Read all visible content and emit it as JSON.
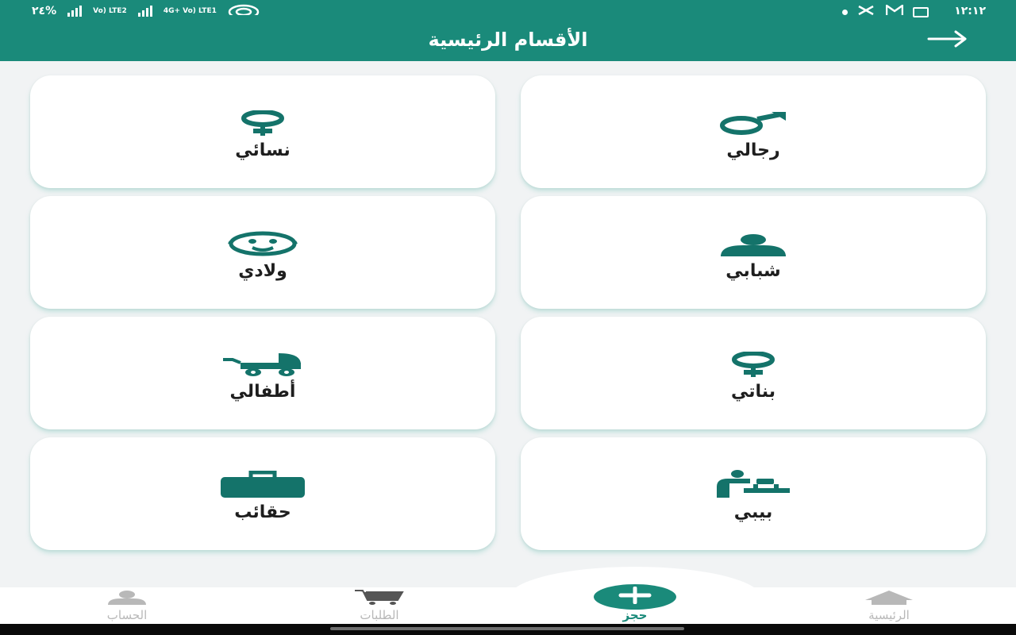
{
  "status_bar": {
    "time": "١٢:١٢",
    "battery": "٢٤%",
    "network_1": "Vo) LTE2",
    "network_2": "4G+ Vo) LTE1"
  },
  "header": {
    "title": "الأقسام الرئيسية",
    "back_icon": "arrow-right-icon"
  },
  "colors": {
    "primary": "#1a8a7a",
    "icon": "#14736a",
    "card_bg": "#ffffff",
    "page_bg": "#f1f3f4",
    "inactive": "#b8b8b8"
  },
  "categories": [
    {
      "label": "رجالي",
      "icon": "male-symbol-icon"
    },
    {
      "label": "نسائي",
      "icon": "female-symbol-icon"
    },
    {
      "label": "شبابي",
      "icon": "young-person-icon"
    },
    {
      "label": "ولادي",
      "icon": "baby-face-icon"
    },
    {
      "label": "بناتي",
      "icon": "female-symbol-icon"
    },
    {
      "label": "أطفالي",
      "icon": "stroller-icon"
    },
    {
      "label": "بيبي",
      "icon": "baby-changing-icon"
    },
    {
      "label": "حقائب",
      "icon": "briefcase-icon"
    }
  ],
  "bottom_nav": {
    "items": [
      {
        "label": "الرئيسية",
        "icon": "home-icon",
        "active": false
      },
      {
        "label": "حجز",
        "icon": "plus-icon",
        "active": true
      },
      {
        "label": "الطلبات",
        "icon": "cart-icon",
        "active": false
      },
      {
        "label": "الحساب",
        "icon": "person-icon",
        "active": false
      }
    ]
  }
}
